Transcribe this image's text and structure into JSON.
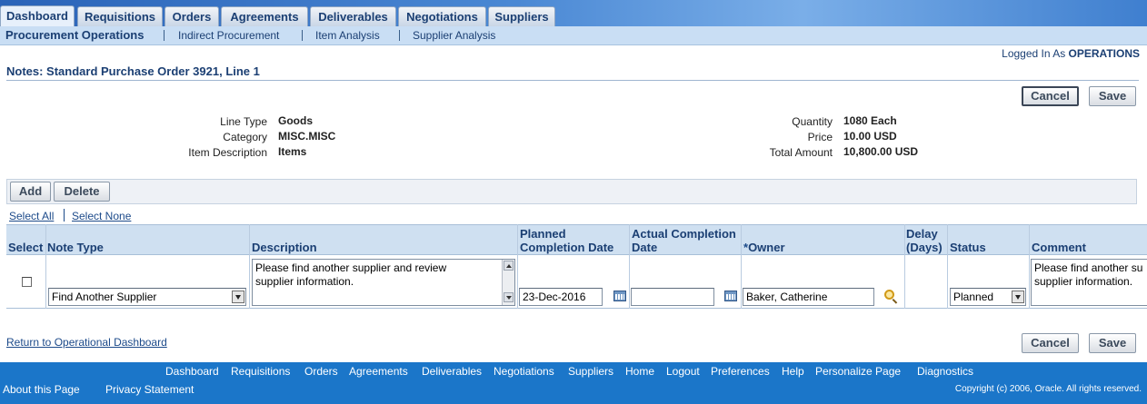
{
  "tabs": [
    "Dashboard",
    "Requisitions",
    "Orders",
    "Agreements",
    "Deliverables",
    "Negotiations",
    "Suppliers"
  ],
  "subtabs": [
    "Procurement Operations",
    "Indirect Procurement",
    "Item Analysis",
    "Supplier Analysis"
  ],
  "logged_in": {
    "prefix": "Logged In As",
    "user": "OPERATIONS"
  },
  "page_title": "Notes: Standard Purchase Order 3921, Line 1",
  "buttons": {
    "cancel": "Cancel",
    "save": "Save",
    "add": "Add",
    "delete": "Delete"
  },
  "line_info": {
    "line_type_label": "Line Type",
    "line_type": "Goods",
    "category_label": "Category",
    "category": "MISC.MISC",
    "item_description_label": "Item Description",
    "item_description": "Items",
    "quantity_label": "Quantity",
    "quantity": "1080 Each",
    "price_label": "Price",
    "price": "10.00 USD",
    "total_amount_label": "Total Amount",
    "total_amount": "10,800.00 USD"
  },
  "selection": {
    "select_all": "Select All",
    "select_none": "Select None"
  },
  "table": {
    "headers": {
      "select": "Select",
      "note_type": "Note Type",
      "description": "Description",
      "planned_line1": "Planned",
      "planned_line2": "Completion Date",
      "actual_line1": "Actual Completion",
      "actual_line2": "Date",
      "owner_required": "*",
      "owner": "Owner",
      "delay_line1": "Delay",
      "delay_line2": "(Days)",
      "status": "Status",
      "comment": "Comment"
    },
    "row": {
      "selected": false,
      "note_type": "Find Another Supplier",
      "description_line1": "Please find another supplier and review",
      "description_line2": "supplier information.",
      "planned_date": "23-Dec-2016",
      "actual_date": "",
      "owner": "Baker, Catherine",
      "delay": "",
      "status": "Planned",
      "comment_line1": "Please find another su",
      "comment_line2": "supplier information."
    }
  },
  "return_link": "Return to Operational Dashboard",
  "footer": {
    "links": [
      "Dashboard",
      "Requisitions",
      "Orders",
      "Agreements",
      "Deliverables",
      "Negotiations",
      "Suppliers",
      "Home",
      "Logout",
      "Preferences",
      "Help",
      "Personalize Page",
      "Diagnostics"
    ],
    "about": "About this Page",
    "privacy": "Privacy Statement",
    "copyright": "Copyright (c) 2006, Oracle. All rights reserved."
  },
  "colors": {
    "header_blue": "#1b3f73",
    "footer_blue": "#1b76c9",
    "table_header_bg": "#cfe0f1"
  },
  "icons": [
    "calendar-icon",
    "search-icon",
    "dropdown-arrow-icon",
    "scroll-up-icon",
    "scroll-down-icon"
  ]
}
